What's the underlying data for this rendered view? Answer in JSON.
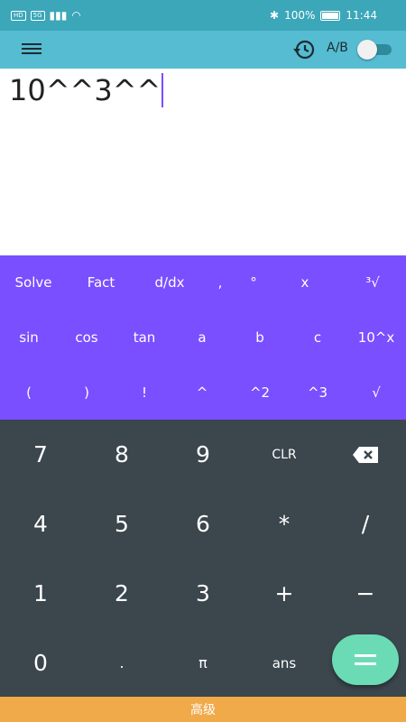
{
  "status": {
    "left_badge_hd": "HD",
    "left_badge_5g": "5G",
    "battery": "100%",
    "time": "11:44"
  },
  "appbar": {
    "ab_label": "A/B",
    "toggle_on": false
  },
  "display": {
    "expression": "10^^3^^"
  },
  "scientific_rows": [
    [
      "Solve",
      "Fact",
      "d/dx",
      ",",
      "°",
      "x",
      "³√"
    ],
    [
      "sin",
      "cos",
      "tan",
      "a",
      "b",
      "c",
      "10^x"
    ],
    [
      "(",
      ")",
      "!",
      "^",
      "^2",
      "^3",
      "√"
    ]
  ],
  "keypad": {
    "row1": [
      "7",
      "8",
      "9",
      "CLR"
    ],
    "row2": [
      "4",
      "5",
      "6",
      "*",
      "/"
    ],
    "row3": [
      "1",
      "2",
      "3",
      "+",
      "−"
    ],
    "row4": [
      "0",
      ".",
      "π",
      "ans"
    ]
  },
  "bottom_bar": {
    "label": "高级"
  },
  "colors": {
    "statusbar": "#3ba7b9",
    "appbar": "#55bcd2",
    "scientific_panel": "#7a4fff",
    "keypad": "#3b464d",
    "equals_button": "#6bdbb6",
    "bottom_bar": "#f0aa4a",
    "cursor": "#7c4dff"
  },
  "icons": {
    "menu": "hamburger-icon",
    "history": "history-icon",
    "backspace": "backspace-icon",
    "equals": "equals-icon"
  }
}
